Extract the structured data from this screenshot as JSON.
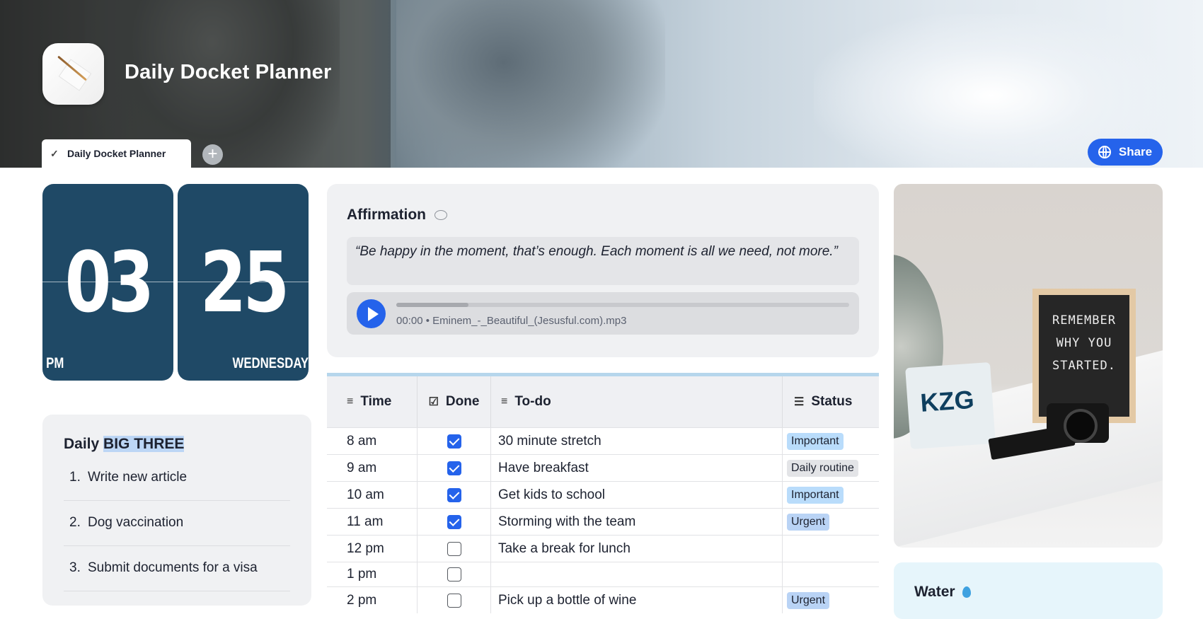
{
  "header": {
    "title": "Daily Docket Planner",
    "tab_label": "Daily Docket Planner",
    "share_label": "Share"
  },
  "clock": {
    "hour": "03",
    "minute": "25",
    "period": "PM",
    "weekday": "WEDNESDAY"
  },
  "big_three": {
    "title_prefix": "Daily ",
    "title_highlight": "BIG THREE",
    "items": [
      {
        "n": "1.",
        "text": "Write new article"
      },
      {
        "n": "2.",
        "text": "Dog vaccination"
      },
      {
        "n": "3.",
        "text": "Submit documents for a visa"
      }
    ]
  },
  "affirmation": {
    "title": "Affirmation",
    "quote": "“Be happy in the moment, that’s enough. Each moment is all we need, not more.”",
    "player": {
      "time": "00:00",
      "file": "Eminem_-_Beautiful_(Jesusful.com).mp3",
      "progress": 0.16
    }
  },
  "schedule": {
    "columns": [
      {
        "icon": "text-lines-icon",
        "label": "Time"
      },
      {
        "icon": "checkbox-icon",
        "label": "Done"
      },
      {
        "icon": "text-lines-icon",
        "label": "To-do"
      },
      {
        "icon": "list-icon",
        "label": "Status"
      }
    ],
    "rows": [
      {
        "time": "8 am",
        "done": true,
        "todo": "30 minute stretch",
        "status": "Important"
      },
      {
        "time": "9 am",
        "done": true,
        "todo": "Have breakfast",
        "status": "Daily routine"
      },
      {
        "time": "10 am",
        "done": true,
        "todo": "Get kids to school",
        "status": "Important"
      },
      {
        "time": "11 am",
        "done": true,
        "todo": "Storming with the team",
        "status": "Urgent"
      },
      {
        "time": "12 pm",
        "done": false,
        "todo": "Take a break for lunch",
        "status": ""
      },
      {
        "time": "1 pm",
        "done": false,
        "todo": "",
        "status": ""
      },
      {
        "time": "2 pm",
        "done": false,
        "todo": "Pick up a bottle of wine",
        "status": "Urgent"
      }
    ],
    "status_colors": {
      "Important": "#b9dcfb",
      "Daily routine": "#e3e4e7",
      "Urgent": "#b9d3f5"
    }
  },
  "photo": {
    "board_lines": [
      "REMEMBER",
      "WHY YOU",
      "STARTED."
    ],
    "plate_text": "KZG"
  },
  "water": {
    "title": "Water"
  },
  "colors": {
    "accent": "#2563eb",
    "clock_bg": "#1f4966",
    "table_top_border": "#b6d6ec"
  }
}
